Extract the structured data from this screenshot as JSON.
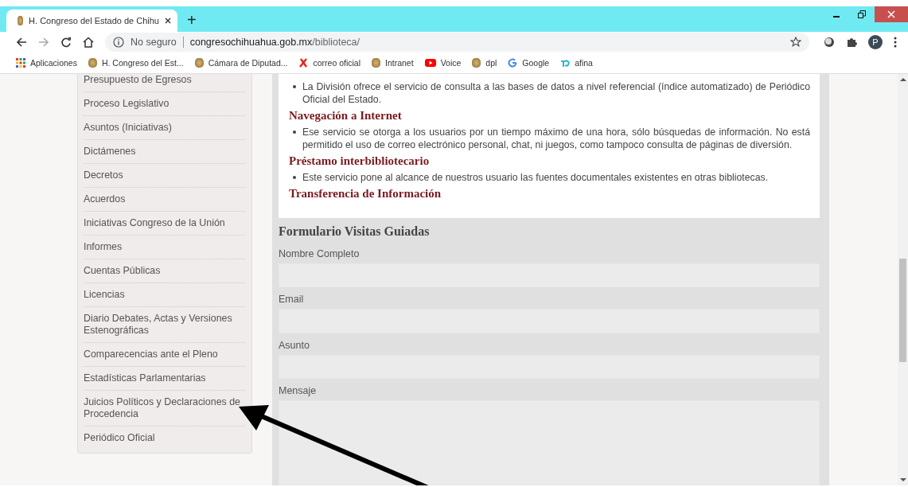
{
  "browser": {
    "tab_title": "H. Congreso del Estado de Chihu",
    "new_tab": "+",
    "security": "No seguro",
    "url_host": "congresochihuahua.gob.mx",
    "url_path": "/biblioteca/",
    "profile_initial": "P",
    "bookmarks": [
      {
        "kind": "apps",
        "label": "Aplicaciones"
      },
      {
        "kind": "seal",
        "label": "H. Congreso del Est..."
      },
      {
        "kind": "seal",
        "label": "Cámara de Diputad..."
      },
      {
        "kind": "cross",
        "label": "correo oficial"
      },
      {
        "kind": "seal",
        "label": "Intranet"
      },
      {
        "kind": "video",
        "label": "Voice"
      },
      {
        "kind": "seal",
        "label": "dpl"
      },
      {
        "kind": "google",
        "label": "Google"
      },
      {
        "kind": "tplink",
        "label": "afina"
      }
    ]
  },
  "sidebar": {
    "items": [
      "Presupuesto de Egresos",
      "Proceso Legislativo",
      "Asuntos (Iniciativas)",
      "Dictámenes",
      "Decretos",
      "Acuerdos",
      "Iniciativas Congreso de la Unión",
      "Informes",
      "Cuentas Públicas",
      "Licencias",
      "Diario Debates, Actas y Versiones Estenográficas",
      "Comparecencias ante el Pleno",
      "Estadísticas Parlamentarias",
      "Juicios Políticos y Declaraciones de Procedencia",
      "Periódico Oficial"
    ]
  },
  "services": [
    {
      "kind": "bullet",
      "text": "La División ofrece el servicio de consulta a las bases de datos a nivel referencial (índice automatizado) de Periódico Oficial del Estado."
    },
    {
      "kind": "heading",
      "text": "Navegación a Internet"
    },
    {
      "kind": "bullet",
      "text": "Ese servicio se otorga a los usuarios por un tiempo máximo de una hora, sólo búsquedas de información. No está permitido el uso de correo electrónico personal, chat, ni juegos, como tampoco consulta de páginas de diversión."
    },
    {
      "kind": "heading",
      "text": "Préstamo interbibliotecario"
    },
    {
      "kind": "bullet",
      "text": "Este servicio pone al alcance de nuestros usuario las fuentes documentales existentes en otras bibliotecas."
    },
    {
      "kind": "heading",
      "text": "Transferencia de Información"
    }
  ],
  "form": {
    "title": "Formulario Visitas Guiadas",
    "fields": [
      {
        "kind": "input",
        "label": "Nombre Completo"
      },
      {
        "kind": "input",
        "label": "Email"
      },
      {
        "kind": "input",
        "label": "Asunto"
      },
      {
        "kind": "textarea",
        "label": "Mensaje"
      }
    ]
  }
}
